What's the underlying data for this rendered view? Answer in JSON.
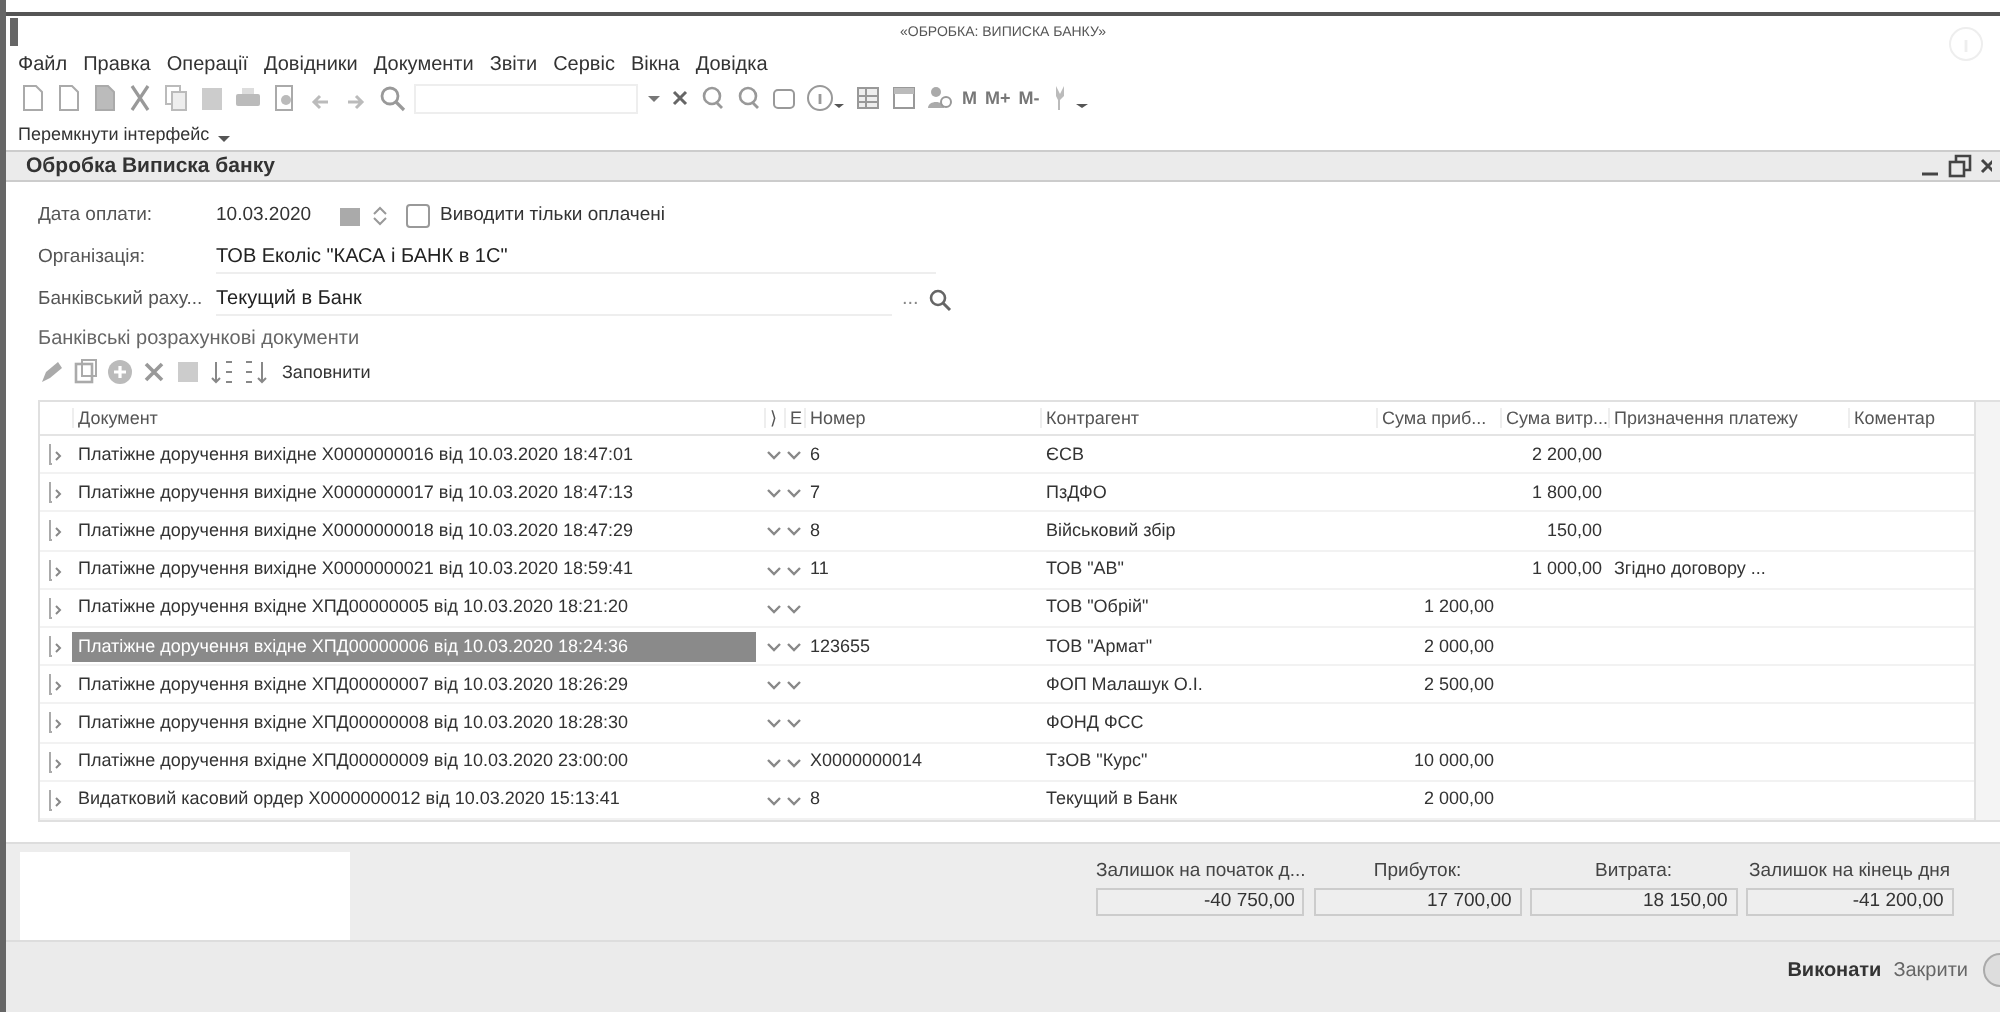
{
  "window": {
    "title": "«ОБРОБКА: ВИПИСКА БАНКУ»"
  },
  "menu": [
    "Файл",
    "Правка",
    "Операції",
    "Довідники",
    "Документи",
    "Звіти",
    "Сервіс",
    "Вікна",
    "Довідка"
  ],
  "toolbar": {
    "memory_buttons": [
      "M",
      "M+",
      "M-"
    ]
  },
  "switch_interface": "Перемкнути інтерфейс",
  "form": {
    "title": "Обробка Виписка банку",
    "date_label": "Дата оплати:",
    "date": "10.03.2020",
    "only_paid": {
      "label": "Виводити тільки оплачені",
      "checked": false
    },
    "org_label": "Організація:",
    "org": "ТОВ Еколіс  \"КАСА і БАНК в 1С\"",
    "account_label": "Банківський раху...",
    "account": "Текущий в Банк",
    "account_dots": "...",
    "section": "Банківські розрахункові документи",
    "fill_button": "Заповнити"
  },
  "table": {
    "columns": [
      "Документ",
      "⟩",
      "Е",
      "Номер",
      "Контрагент",
      "Сума приб...",
      "Сума витр...",
      "Призначення платежу",
      "Коментар"
    ],
    "rows": [
      {
        "document": "Платіжне доручення вихідне Х0000000016 від 10.03.2020 18:47:01",
        "number": "6",
        "counterparty": "ЄСВ",
        "income": "",
        "expense": "2 200,00",
        "purpose": "",
        "selected": false
      },
      {
        "document": "Платіжне доручення вихідне Х0000000017 від 10.03.2020 18:47:13",
        "number": "7",
        "counterparty": "ПзДФО",
        "income": "",
        "expense": "1 800,00",
        "purpose": "",
        "selected": false
      },
      {
        "document": "Платіжне доручення вихідне Х0000000018 від 10.03.2020 18:47:29",
        "number": "8",
        "counterparty": "Військовий збір",
        "income": "",
        "expense": "150,00",
        "purpose": "",
        "selected": false
      },
      {
        "document": "Платіжне доручення вихідне Х0000000021 від 10.03.2020 18:59:41",
        "number": "11",
        "counterparty": "ТОВ \"АВ\"",
        "income": "",
        "expense": "1 000,00",
        "purpose": "Згідно договору ...",
        "selected": false
      },
      {
        "document": "Платіжне доручення вхідне ХПД00000005 від 10.03.2020 18:21:20",
        "number": "",
        "counterparty": "ТОВ \"Обрій\"",
        "income": "1 200,00",
        "expense": "",
        "purpose": "",
        "selected": false
      },
      {
        "document": "Платіжне доручення вхідне ХПД00000006 від 10.03.2020 18:24:36",
        "number": "123655",
        "counterparty": "ТОВ \"Армат\"",
        "income": "2 000,00",
        "expense": "",
        "purpose": "",
        "selected": true
      },
      {
        "document": "Платіжне доручення вхідне ХПД00000007 від 10.03.2020 18:26:29",
        "number": "",
        "counterparty": "ФОП Малашук О.І.",
        "income": "2 500,00",
        "expense": "",
        "purpose": "",
        "selected": false
      },
      {
        "document": "Платіжне доручення вхідне ХПД00000008 від 10.03.2020 18:28:30",
        "number": "",
        "counterparty": "ФОНД ФСС",
        "income": "",
        "expense": "",
        "purpose": "",
        "selected": false
      },
      {
        "document": "Платіжне доручення вхідне ХПД00000009 від 10.03.2020 23:00:00",
        "number": "Х0000000014",
        "counterparty": "ТзОВ \"Курс\"",
        "income": "10 000,00",
        "expense": "",
        "purpose": "",
        "selected": false
      },
      {
        "document": "Видатковий касовий ордер Х0000000012 від 10.03.2020 15:13:41",
        "number": "8",
        "counterparty": "Текущий в Банк",
        "income": "2 000,00",
        "expense": "",
        "purpose": "",
        "selected": false
      }
    ]
  },
  "totals": [
    {
      "label": "Залишок на початок д...",
      "value": "-40 750,00"
    },
    {
      "label": "Прибуток:",
      "value": "17 700,00"
    },
    {
      "label": "Витрата:",
      "value": "18 150,00"
    },
    {
      "label": "Залишок на кінець дня",
      "value": "-41 200,00"
    }
  ],
  "buttons": [
    {
      "label": "Виконати",
      "kind": "primary"
    },
    {
      "label": "Закрити",
      "kind": "plain"
    }
  ]
}
